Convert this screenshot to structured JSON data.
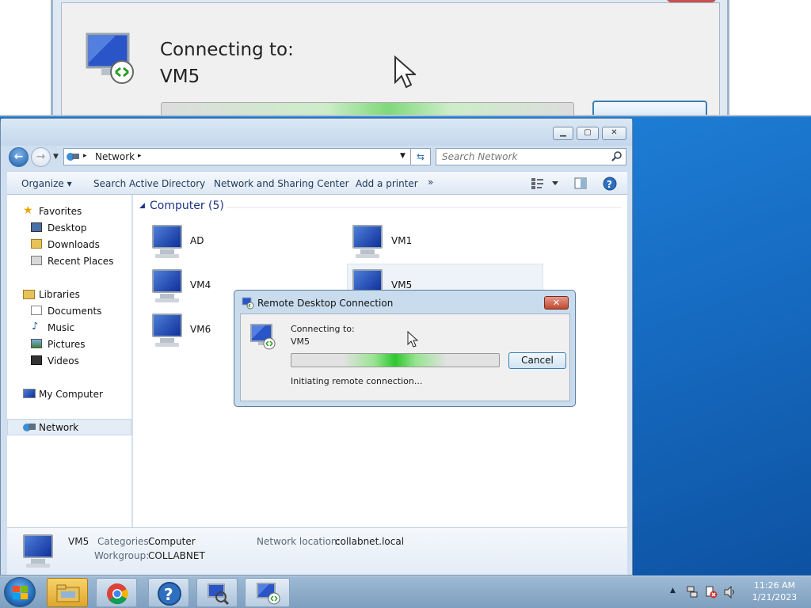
{
  "zoom": {
    "connecting_to": "Connecting to:",
    "target": "VM5"
  },
  "explorer": {
    "address": {
      "crumb": "Network"
    },
    "search_placeholder": "Search Network",
    "commands": {
      "organize": "Organize",
      "search_ad": "Search Active Directory",
      "nsc": "Network and Sharing Center",
      "add_printer": "Add a printer",
      "more": "»"
    },
    "nav": {
      "favorites": "Favorites",
      "desktop": "Desktop",
      "downloads": "Downloads",
      "recent": "Recent Places",
      "libraries": "Libraries",
      "documents": "Documents",
      "music": "Music",
      "pictures": "Pictures",
      "videos": "Videos",
      "my_computer": "My Computer",
      "network": "Network"
    },
    "group_header": "Computer (5)",
    "computers": [
      "AD",
      "VM1",
      "VM4",
      "VM5",
      "VM6"
    ],
    "details": {
      "name": "VM5",
      "categories_label": "Categories:",
      "categories_value": "Computer",
      "workgroup_label": "Workgroup:",
      "workgroup_value": "COLLABNET",
      "location_label": "Network location:",
      "location_value": "collabnet.local"
    }
  },
  "rdp": {
    "title": "Remote Desktop Connection",
    "connecting_to": "Connecting to:",
    "target": "VM5",
    "cancel": "Cancel",
    "status": "Initiating remote connection..."
  },
  "taskbar": {
    "time": "11:26 AM",
    "date": "1/21/2023"
  },
  "colors": {
    "accent": "#1e395b",
    "group_header": "#1e3287",
    "progress": "#2fc72f"
  }
}
